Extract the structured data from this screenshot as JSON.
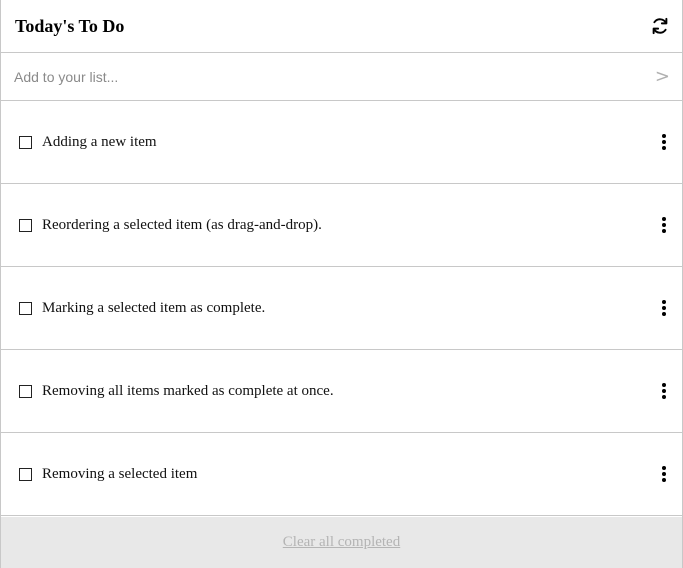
{
  "header": {
    "title": "Today's To Do",
    "refresh_icon": "refresh-icon"
  },
  "add": {
    "placeholder": "Add to your list...",
    "submit_glyph": ">"
  },
  "items": [
    {
      "label": "Adding a new item",
      "completed": false
    },
    {
      "label": "Reordering a selected item (as drag-and-drop).",
      "completed": false
    },
    {
      "label": "Marking a selected item as complete.",
      "completed": false
    },
    {
      "label": "Removing all items marked as complete at once.",
      "completed": false
    },
    {
      "label": "Removing a selected item",
      "completed": false
    }
  ],
  "footer": {
    "clear_label": "Clear all completed"
  },
  "colors": {
    "border": "#c8c8c8",
    "footer_bg": "#e8e8e8",
    "disabled_text": "#b4b4b4"
  }
}
